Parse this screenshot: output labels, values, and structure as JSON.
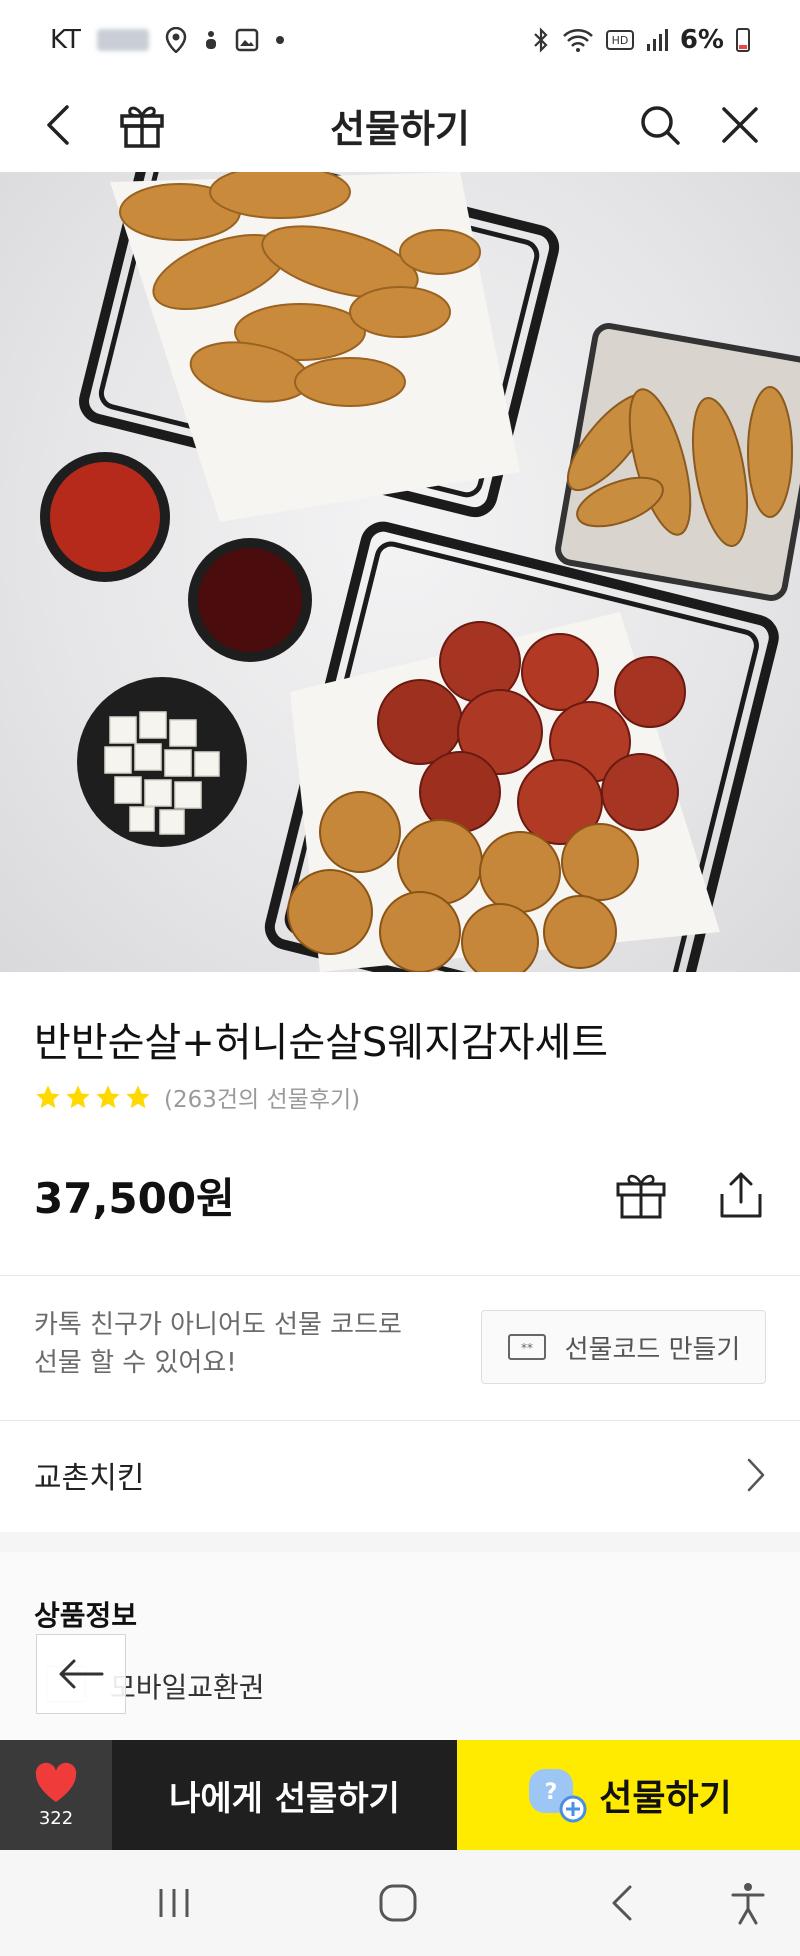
{
  "status_bar": {
    "carrier": "KT",
    "battery_text": "6%",
    "icons": [
      "location-icon",
      "notification-icon",
      "gallery-icon",
      "dot-icon",
      "bluetooth-icon",
      "wifi-icon",
      "hd-icon",
      "signal-icon",
      "battery-icon"
    ]
  },
  "header": {
    "title": "선물하기",
    "icons": [
      "back-arrow-icon",
      "gift-box-icon",
      "search-icon",
      "close-icon"
    ]
  },
  "product": {
    "name": "반반순살+허니순살S웨지감자세트",
    "rating": 4,
    "rating_max": 4,
    "review_text": "(263건의 선물후기)",
    "price": "37,500원",
    "actions": [
      "gift-icon",
      "share-icon"
    ]
  },
  "gift_code": {
    "description_line1": "카톡 친구가 아니어도 선물 코드로",
    "description_line2": "선물 할 수 있어요!",
    "button_label": "선물코드 만들기"
  },
  "brand": {
    "name": "교촌치킨"
  },
  "product_info": {
    "title": "상품정보",
    "type_label": "모바일교환권"
  },
  "bottom_bar": {
    "wish_count": "322",
    "gift_self_label": "나에게 선물하기",
    "gift_label": "선물하기"
  },
  "colors": {
    "cta_yellow": "#ffeb00",
    "cta_dark": "#1f1f1f",
    "heart_red": "#f03b3b",
    "star_yellow": "#ffd800"
  }
}
